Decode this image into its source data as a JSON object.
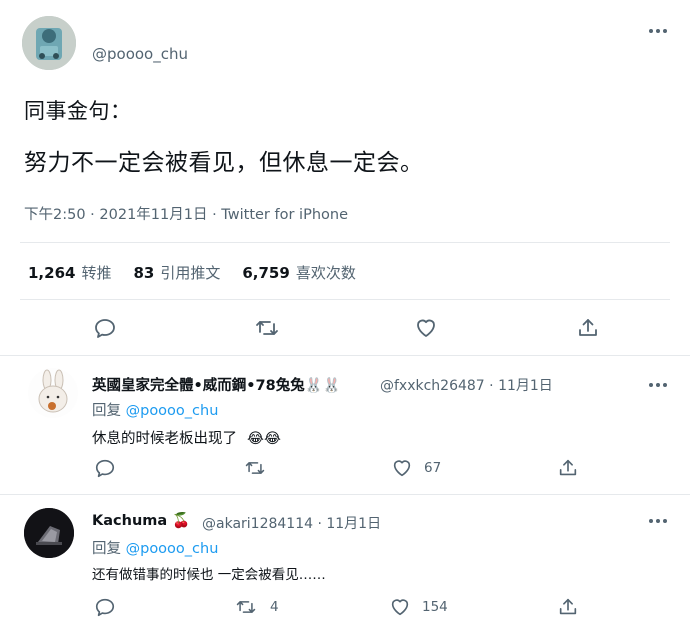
{
  "main_tweet": {
    "handle": "@poooo_chu",
    "line1": "同事金句：",
    "line2": "努力不一定会被看见，但休息一定会。",
    "meta": "下午2:50 · 2021年11月1日 · Twitter for iPhone",
    "stats": [
      {
        "number": "1,264",
        "label": "转推"
      },
      {
        "number": "83",
        "label": "引用推文"
      },
      {
        "number": "6,759",
        "label": "喜欢次数"
      }
    ],
    "actions": [
      "reply-icon",
      "retweet-icon",
      "like-icon",
      "share-icon"
    ]
  },
  "replies": [
    {
      "name": "英國皇家完全體•威而鋼•78兔兔",
      "name_emoji": "🐰🐰",
      "handle_date": "@fxxkch26487 · 11月1日",
      "reply_prefix": "回复",
      "reply_to": "@poooo_chu",
      "text": "休息的时候老板出现了",
      "text_emoji": "😂😂",
      "retweets": "",
      "likes": "67"
    },
    {
      "name": "Kachuma",
      "name_emoji": "🍒",
      "handle_date": "@akari1284114 · 11月1日",
      "reply_prefix": "回复",
      "reply_to": "@poooo_chu",
      "text": "还有做错事的时候也 一定会被看见……",
      "text_emoji": "",
      "retweets": "4",
      "likes": "154"
    }
  ],
  "colors": {
    "accent": "#1d9bf0",
    "muted": "#536471",
    "text": "#0f1419",
    "divider": "#e6e9ec"
  }
}
